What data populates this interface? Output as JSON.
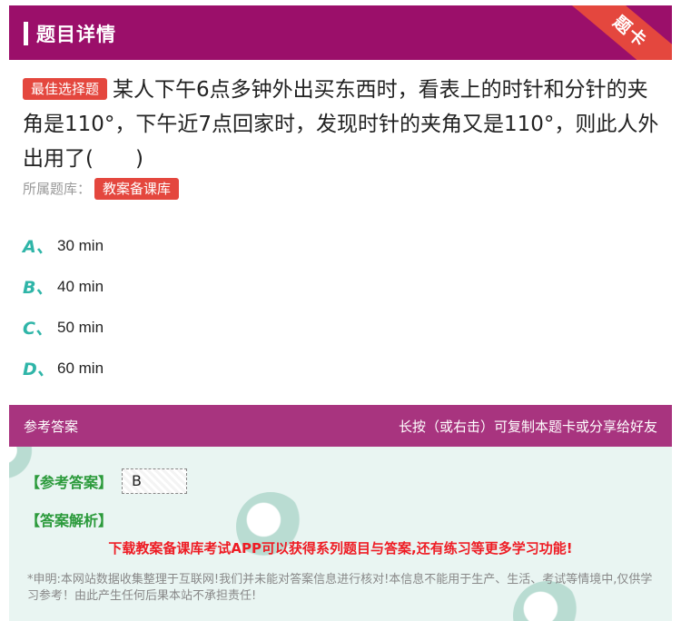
{
  "header": {
    "title": "题目详情",
    "ribbon": "题卡"
  },
  "question": {
    "badge": "最佳选择题",
    "text": "某人下午6点多钟外出买东西时，看表上的时针和分针的夹角是110°，下午近7点回家时，发现时针的夹角又是110°，则此人外出用了(　　)",
    "source_label": "所属题库：",
    "source_value": "教案备课库"
  },
  "options": [
    {
      "letter": "A、",
      "text": "30 min"
    },
    {
      "letter": "B、",
      "text": "40 min"
    },
    {
      "letter": "C、",
      "text": "50 min"
    },
    {
      "letter": "D、",
      "text": "60 min"
    }
  ],
  "answer_panel": {
    "title": "参考答案",
    "hint": "长按（或右击）可复制本题卡或分享给好友",
    "answer_label": "【参考答案】",
    "answer_value": "B",
    "analysis_label": "【答案解析】",
    "promo": "下载教案备课库考试APP可以获得系列题目与答案,还有练习等更多学习功能!",
    "disclaimer": "*申明:本网站数据收集整理于互联网!我们并未能对答案信息进行核对!本信息不能用于生产、生活、考试等情境中,仅供学习参考！由此产生任何后果本站不承担责任!"
  },
  "colors": {
    "header_bg": "#9b0f6a",
    "ribbon_bg": "#e4473e",
    "badge_bg": "#e4473e",
    "option_letter": "#2fb5a8",
    "answer_head_bg": "#a8347f",
    "answer_label": "#2b9a3b",
    "promo_text": "#ee1c24"
  }
}
